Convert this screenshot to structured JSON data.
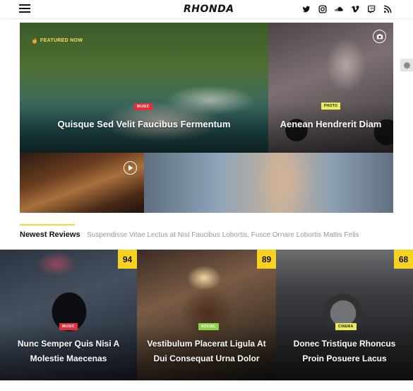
{
  "header": {
    "logo": "RHONDA",
    "social_icons": [
      "twitter-icon",
      "instagram-icon",
      "soundcloud-icon",
      "vimeo-icon",
      "twitch-icon",
      "rss-icon"
    ]
  },
  "hero": {
    "main": {
      "badge": "FEATURED NOW",
      "category": "MUSIC",
      "title": "Quisque Sed Velit Faucibus Fermentum"
    },
    "side": {
      "category": "PHOTO",
      "title": "Aenean Hendrerit Diam"
    }
  },
  "ticker": {
    "label": "Newest Reviews",
    "text": "Suspendisse Vitae Lectus at Nisl Faucibus Lobortis, Fusce Ornare Lobortis Mattis Felis"
  },
  "reviews": [
    {
      "score": "94",
      "category": "MUSIC",
      "title": "Nunc Semper Quis Nisi A Molestie Maecenas"
    },
    {
      "score": "89",
      "category": "SOCIAL",
      "title": "Vestibulum Placerat Ligula At Dui Consequat Urna Dolor"
    },
    {
      "score": "68",
      "category": "CINEMA",
      "title": "Donec Tristique Rhoncus Proin Posuere Lacus"
    }
  ],
  "colors": {
    "accent_yellow": "#f7d21e",
    "category_red": "#e62d3b",
    "category_yellow": "#ecec5a",
    "category_green": "#8fd24a"
  }
}
